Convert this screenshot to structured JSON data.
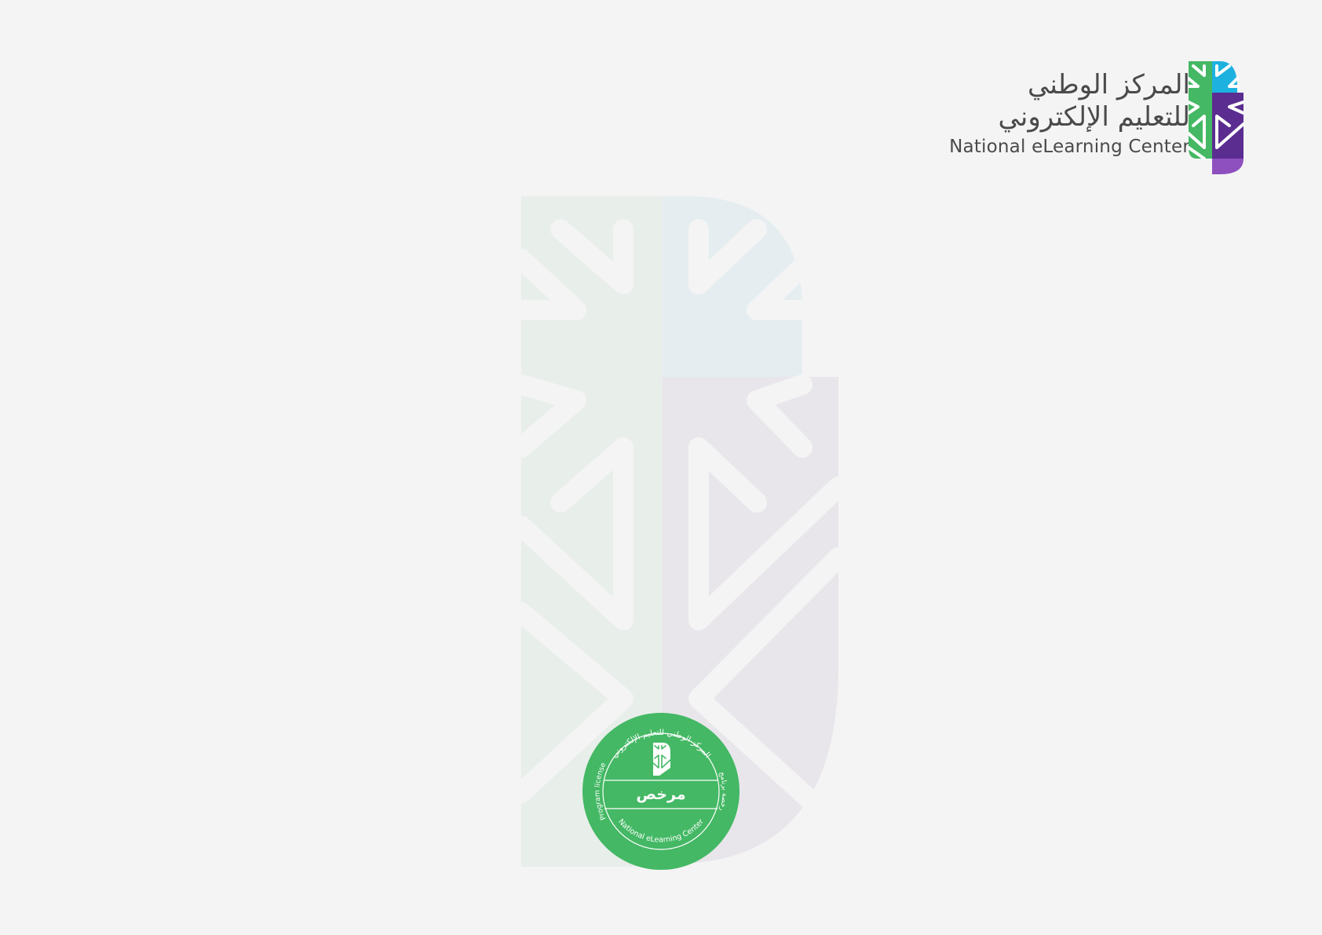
{
  "header": {
    "org_name_ar_line1": "المركز الوطني",
    "org_name_ar_line2": "للتعليم الإلكتروني",
    "org_name_en": "National eLearning Center",
    "logo_icon": "nelc-logo-mark-icon"
  },
  "seal": {
    "top_arc_text_ar": "المركز الوطني للتعليم الإلكتروني",
    "left_arc_text_en": "Program license",
    "right_arc_text_ar": "رخصة برنامج",
    "bottom_arc_text_en": "National eLearning Center",
    "center_label_ar": "مرخص",
    "icon": "nelc-seal-mark-icon"
  },
  "watermark": {
    "icon": "nelc-watermark-icon"
  },
  "colors": {
    "background": "#f4f4f4",
    "brand_green": "#44b864",
    "brand_cyan": "#1db1e0",
    "brand_purple": "#5b2d90",
    "brand_violet": "#8e4fbf",
    "text_gray": "#4a4a4a"
  }
}
